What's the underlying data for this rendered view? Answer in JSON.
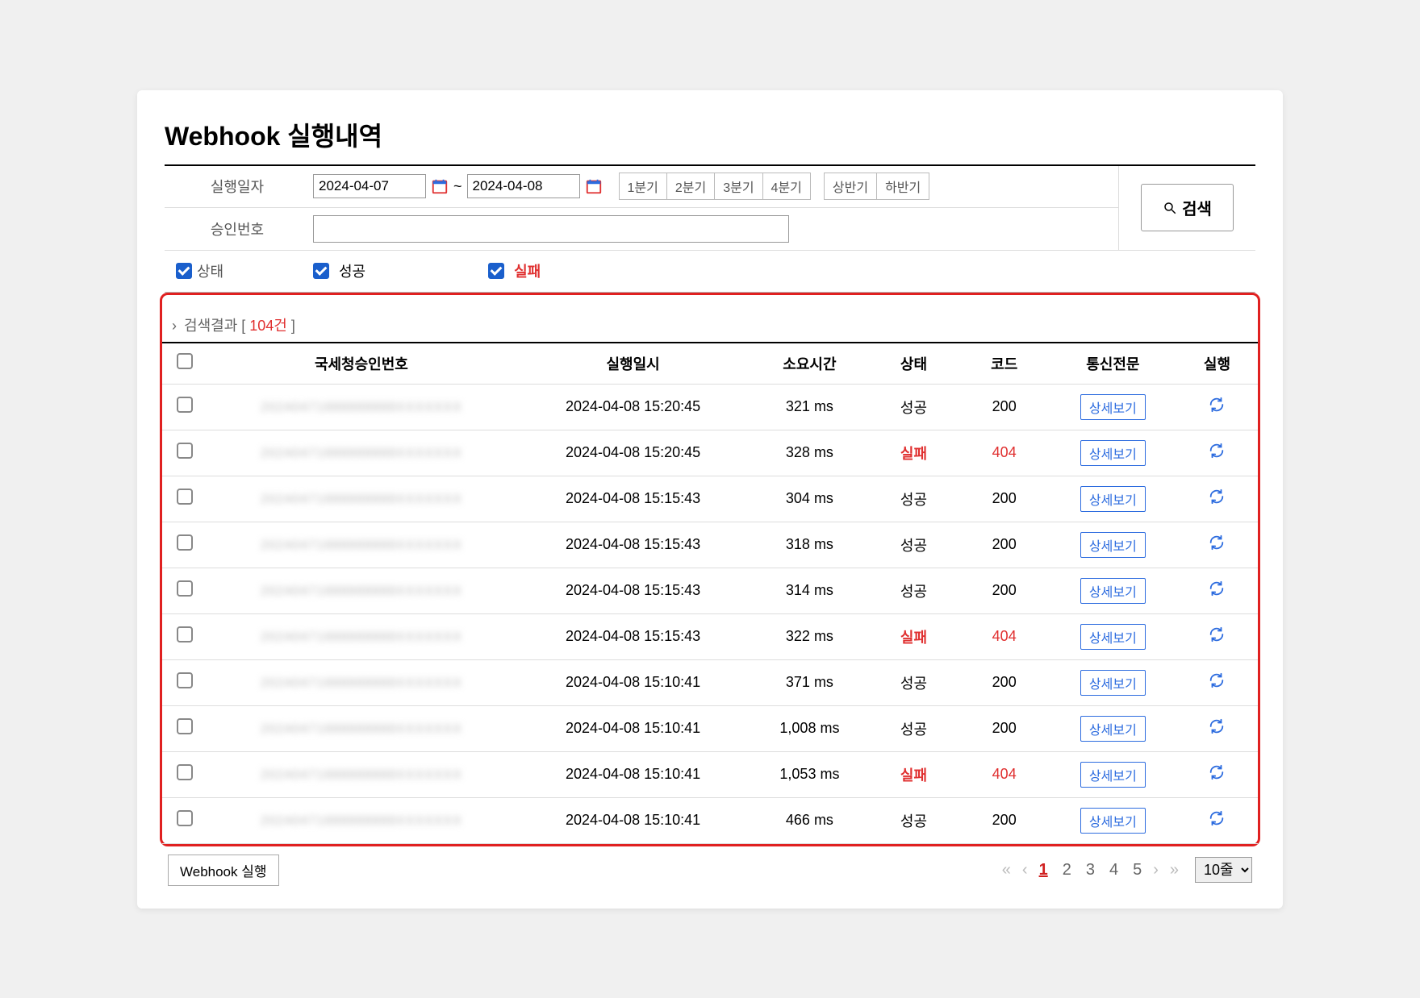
{
  "title": "Webhook 실행내역",
  "filter": {
    "date_label": "실행일자",
    "date_from": "2024-04-07",
    "date_sep": "~",
    "date_to": "2024-04-08",
    "quick_quarters": [
      "1분기",
      "2분기",
      "3분기",
      "4분기"
    ],
    "quick_halves": [
      "상반기",
      "하반기"
    ],
    "approval_label": "승인번호",
    "approval_value": "",
    "status_label": "상태",
    "status_success": "성공",
    "status_fail": "실패"
  },
  "search_button": "검색",
  "result": {
    "prefix": "검색결과 [ ",
    "count": "104건",
    "suffix": " ]"
  },
  "columns": {
    "approval": "국세청승인번호",
    "time": "실행일시",
    "duration": "소요시간",
    "status": "상태",
    "code": "코드",
    "message": "통신전문",
    "run": "실행"
  },
  "detail_button": "상세보기",
  "rows": [
    {
      "approval": "20240471888888888XXXXXXX",
      "time": "2024-04-08 15:20:45",
      "duration": "321 ms",
      "status": "성공",
      "code": "200",
      "fail": false
    },
    {
      "approval": "20240471888888888XXXXXXX",
      "time": "2024-04-08 15:20:45",
      "duration": "328 ms",
      "status": "실패",
      "code": "404",
      "fail": true
    },
    {
      "approval": "20240471888888888XXXXXXX",
      "time": "2024-04-08 15:15:43",
      "duration": "304 ms",
      "status": "성공",
      "code": "200",
      "fail": false
    },
    {
      "approval": "20240471888888888XXXXXXX",
      "time": "2024-04-08 15:15:43",
      "duration": "318 ms",
      "status": "성공",
      "code": "200",
      "fail": false
    },
    {
      "approval": "20240471888888888XXXXXXX",
      "time": "2024-04-08 15:15:43",
      "duration": "314 ms",
      "status": "성공",
      "code": "200",
      "fail": false
    },
    {
      "approval": "20240471888888888XXXXXXX",
      "time": "2024-04-08 15:15:43",
      "duration": "322 ms",
      "status": "실패",
      "code": "404",
      "fail": true
    },
    {
      "approval": "20240471888888888XXXXXXX",
      "time": "2024-04-08 15:10:41",
      "duration": "371 ms",
      "status": "성공",
      "code": "200",
      "fail": false
    },
    {
      "approval": "20240471888888888XXXXXXX",
      "time": "2024-04-08 15:10:41",
      "duration": "1,008 ms",
      "status": "성공",
      "code": "200",
      "fail": false
    },
    {
      "approval": "20240471888888888XXXXXXX",
      "time": "2024-04-08 15:10:41",
      "duration": "1,053 ms",
      "status": "실패",
      "code": "404",
      "fail": true
    },
    {
      "approval": "20240471888888888XXXXXXX",
      "time": "2024-04-08 15:10:41",
      "duration": "466 ms",
      "status": "성공",
      "code": "200",
      "fail": false
    }
  ],
  "footer": {
    "webhook_run": "Webhook 실행",
    "pages": [
      "1",
      "2",
      "3",
      "4",
      "5"
    ],
    "active_page": "1",
    "rows_per_page": "10줄"
  }
}
